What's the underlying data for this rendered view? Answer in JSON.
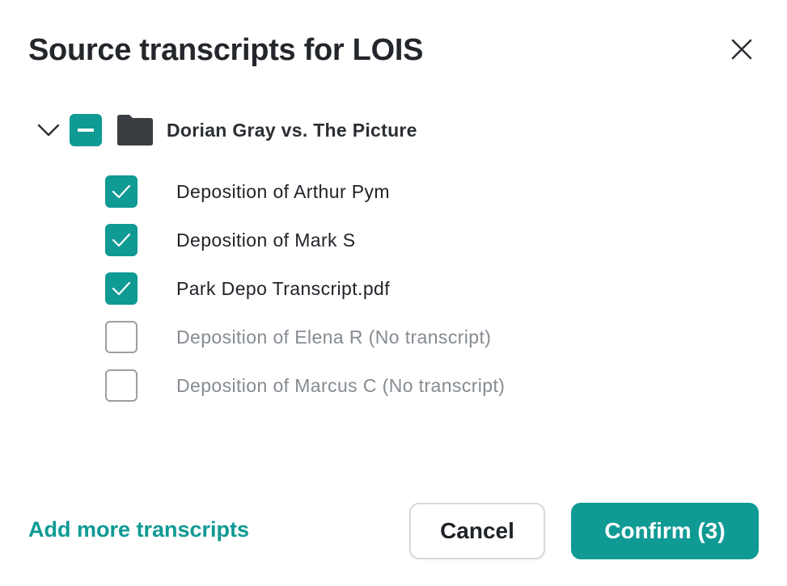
{
  "dialog": {
    "title": "Source transcripts for LOIS",
    "close_icon": "close-icon"
  },
  "folder": {
    "name": "Dorian Gray vs. The Picture",
    "expanded": true,
    "selection_state": "partial",
    "icons": {
      "chevron": "chevron-down-icon",
      "folder": "folder-icon"
    }
  },
  "items": [
    {
      "label": "Deposition of Arthur Pym",
      "checked": true,
      "disabled": false
    },
    {
      "label": "Deposition of Mark S",
      "checked": true,
      "disabled": false
    },
    {
      "label": "Park Depo Transcript.pdf",
      "checked": true,
      "disabled": false
    },
    {
      "label": "Deposition of Elena R (No transcript)",
      "checked": false,
      "disabled": true
    },
    {
      "label": "Deposition of Marcus C (No transcript)",
      "checked": false,
      "disabled": true
    }
  ],
  "footer": {
    "add_more_label": "Add more transcripts",
    "cancel_label": "Cancel",
    "confirm_label": "Confirm (3)"
  },
  "colors": {
    "accent": "#0f9a94",
    "text_primary": "#1f2328",
    "text_disabled": "#858b91",
    "checkbox_border": "#9aa0a6"
  }
}
